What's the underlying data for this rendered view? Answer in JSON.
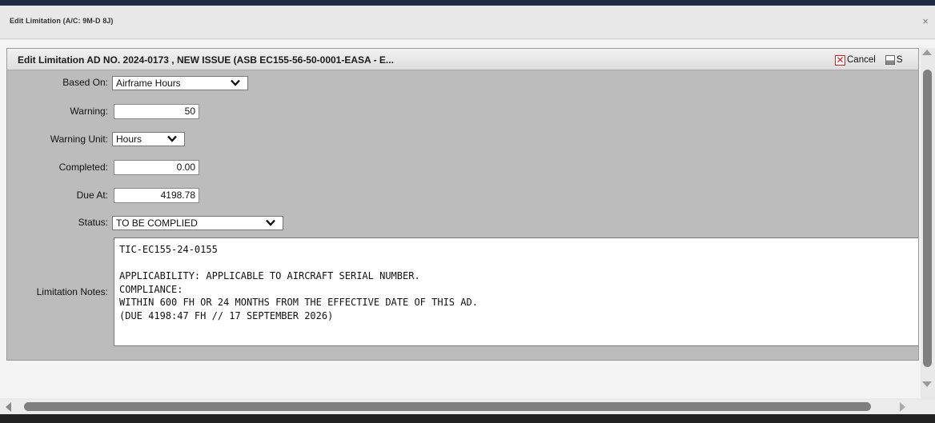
{
  "dialog": {
    "title": "Edit Limitation (A/C: 9M-D 8J)",
    "close_glyph": "×"
  },
  "panel": {
    "title": "Edit Limitation AD NO. 2024-0173 , NEW ISSUE (ASB EC155-56-50-0001-EASA - E...",
    "cancel_label": "Cancel",
    "save_label": "S",
    "icons": {
      "cancel": "cancel-x-icon",
      "save": "save-disk-icon"
    }
  },
  "form": {
    "based_on": {
      "label": "Based On:",
      "value": "Airframe Hours"
    },
    "warning": {
      "label": "Warning:",
      "value": "50"
    },
    "warning_unit": {
      "label": "Warning Unit:",
      "value": "Hours"
    },
    "completed": {
      "label": "Completed:",
      "value": "0.00"
    },
    "due_at": {
      "label": "Due At:",
      "value": "4198.78"
    },
    "status": {
      "label": "Status:",
      "value": "TO BE COMPLIED"
    },
    "notes": {
      "label": "Limitation Notes:",
      "lines": [
        "TIC-EC155-24-0155",
        "",
        "APPLICABILITY: APPLICABLE TO AIRCRAFT SERIAL NUMBER.",
        "COMPLIANCE:",
        "WITHIN 600 FH OR 24 MONTHS FROM THE EFFECTIVE DATE OF THIS AD.",
        "(DUE 4198:47 FH // 17 SEPTEMBER 2026)"
      ]
    }
  },
  "colors": {
    "top_bar": "#1e2b40",
    "panel_bg": "#bcbcbc",
    "cancel_red": "#d02020"
  }
}
